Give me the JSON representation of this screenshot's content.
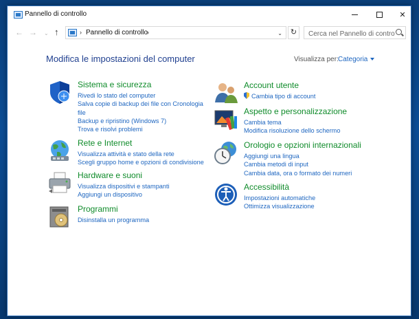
{
  "window": {
    "title": "Pannello di controllo",
    "close_glyph": "✕"
  },
  "nav": {
    "back": "←",
    "forward": "→",
    "dropdown": "⌄",
    "up": "↑",
    "breadcrumb_sep": "›",
    "breadcrumb": "Pannello di controllo",
    "address_dropdown": "⌄",
    "refresh": "↻",
    "search_placeholder": "Cerca nel Pannello di controllo"
  },
  "main": {
    "title": "Modifica le impostazioni del computer",
    "view_by_label": "Visualizza per:",
    "view_by_value": "Categoria"
  },
  "left_categories": [
    {
      "icon": "shield-icon",
      "title": "Sistema e sicurezza",
      "links": [
        "Rivedi lo stato del computer",
        "Salva copie di backup dei file con Cronologia file",
        "Backup e ripristino (Windows 7)",
        "Trova e risolvi problemi"
      ]
    },
    {
      "icon": "network-globe-icon",
      "title": "Rete e Internet",
      "links": [
        "Visualizza attività e stato della rete",
        "Scegli gruppo home e opzioni di condivisione"
      ]
    },
    {
      "icon": "printer-icon",
      "title": "Hardware e suoni",
      "links": [
        "Visualizza dispositivi e stampanti",
        "Aggiungi un dispositivo"
      ]
    },
    {
      "icon": "programs-disc-icon",
      "title": "Programmi",
      "links": [
        "Disinstalla un programma"
      ]
    }
  ],
  "right_categories": [
    {
      "icon": "users-icon",
      "title": "Account utente",
      "links": [
        "Cambia tipo di account"
      ]
    },
    {
      "icon": "appearance-palette-icon",
      "title": "Aspetto e personalizzazione",
      "links": [
        "Cambia tema",
        "Modifica risoluzione dello schermo"
      ]
    },
    {
      "icon": "clock-globe-icon",
      "title": "Orologio e opzioni internazionali",
      "links": [
        "Aggiungi una lingua",
        "Cambia metodi di input",
        "Cambia data, ora o formato dei numeri"
      ]
    },
    {
      "icon": "accessibility-icon",
      "title": "Accessibilità",
      "links": [
        "Impostazioni automatiche",
        "Ottimizza visualizzazione"
      ]
    }
  ],
  "colors": {
    "category_title": "#0f8b2a",
    "link": "#1e66c0",
    "page_title": "#1f3f8f",
    "desktop": "#0b4d96"
  }
}
